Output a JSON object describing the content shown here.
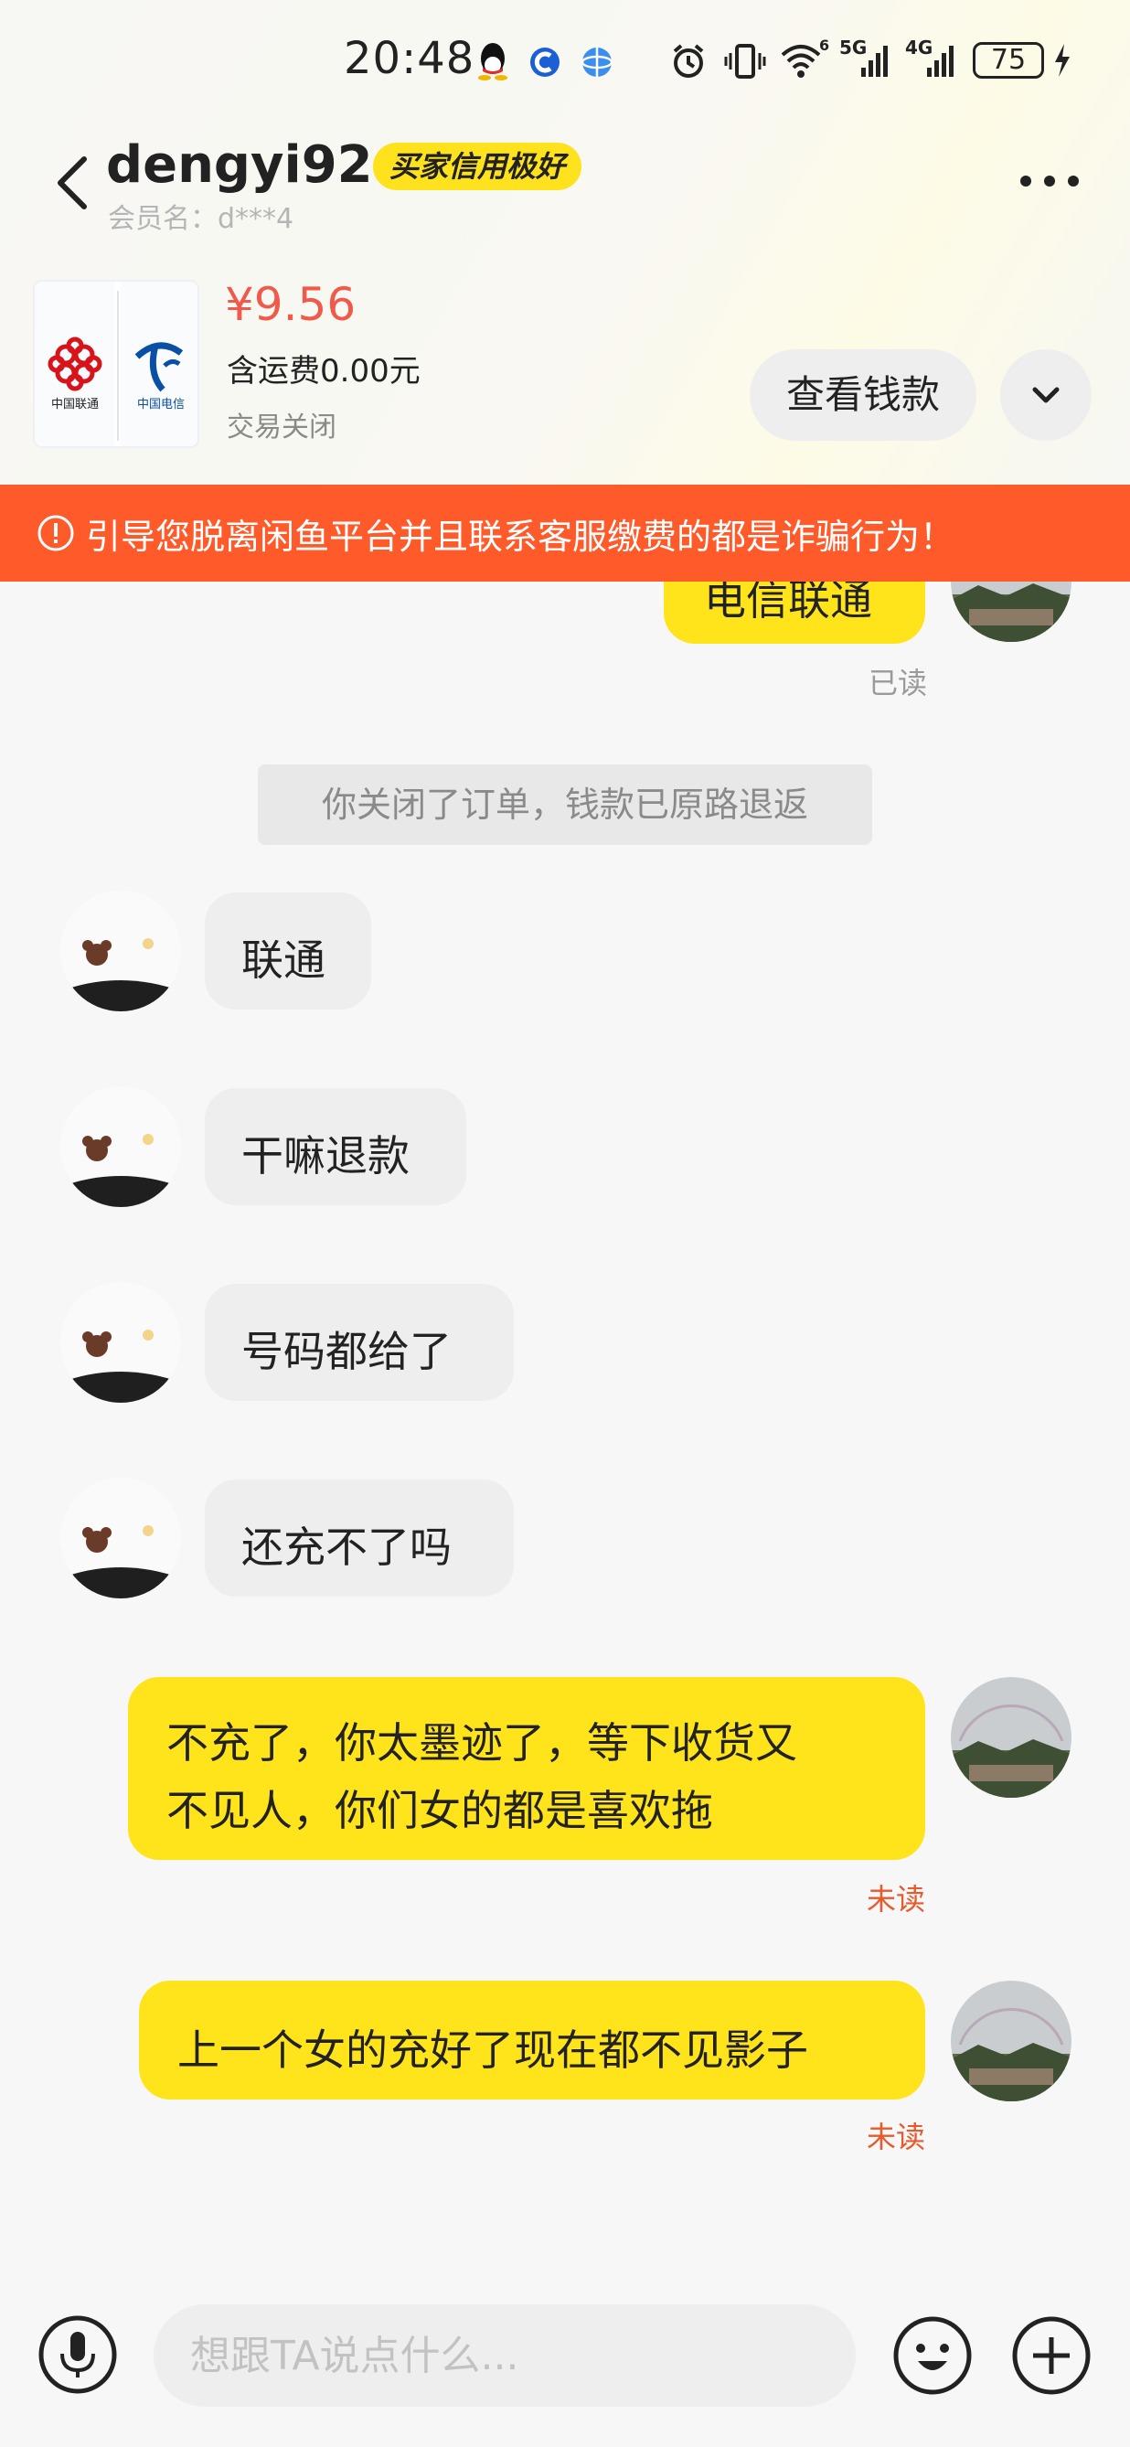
{
  "status_bar": {
    "time": "20:48",
    "signal_5g": "5G",
    "signal_4g": "4G",
    "wifi_sub": "6",
    "battery": "75"
  },
  "header": {
    "username": "dengyi924",
    "credit_badge": "买家信用极好",
    "member_label": "会员名：d***4"
  },
  "product": {
    "price": "¥9.56",
    "shipping": "含运费0.00元",
    "status": "交易关闭",
    "logo_left_text": "中国联通",
    "logo_right_text": "中国电信",
    "view_money_label": "查看钱款"
  },
  "warning": {
    "text": "引导您脱离闲鱼平台并且联系客服缴费的都是诈骗行为！"
  },
  "messages": {
    "m0": {
      "text": "电信联通",
      "status": "已读"
    },
    "system": "你关闭了订单，钱款已原路退返",
    "r1": "联通",
    "r2": "干嘛退款",
    "r3": "号码都给了",
    "r4": "还充不了吗",
    "s1": {
      "line1": "不充了，你太墨迹了，等下收货又",
      "line2": "不见人，你们女的都是喜欢拖",
      "status": "未读"
    },
    "s2": {
      "text": "上一个女的充好了现在都不见影子",
      "status": "未读"
    }
  },
  "input": {
    "placeholder": "想跟TA说点什么..."
  },
  "colors": {
    "accent_yellow": "#ffe41c",
    "price_red": "#f05a4a",
    "warning_orange": "#fe5a2a",
    "unread_orange": "#e8592c",
    "read_grey": "#9a9a9a"
  }
}
